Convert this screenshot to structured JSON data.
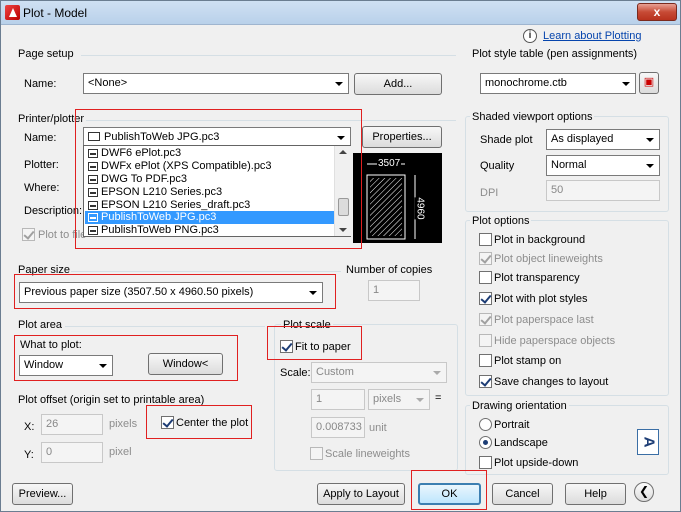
{
  "window": {
    "title": "Plot - Model",
    "close_label": "x",
    "info_link": "Learn about Plotting"
  },
  "page_setup": {
    "heading": "Page setup",
    "name_label": "Name:",
    "name_value": "<None>",
    "add_button": "Add..."
  },
  "printer": {
    "heading": "Printer/plotter",
    "name_label": "Name:",
    "name_value": "PublishToWeb JPG.pc3",
    "properties_button": "Properties...",
    "plotter_label": "Plotter:",
    "where_label": "Where:",
    "description_label": "Description:",
    "plot_to_file_label": "Plot to file",
    "dropdown_items": [
      "DWF6 ePlot.pc3",
      "DWFx ePlot (XPS Compatible).pc3",
      "DWG To PDF.pc3",
      "EPSON L210 Series.pc3",
      "EPSON L210 Series_draft.pc3",
      "PublishToWeb JPG.pc3",
      "PublishToWeb PNG.pc3"
    ],
    "selected_index": 5,
    "preview_width": "3507",
    "preview_height": "4960"
  },
  "paper_size": {
    "heading": "Paper size",
    "value": "Previous paper size  (3507.50 x 4960.50 pixels)"
  },
  "copies": {
    "heading": "Number of copies",
    "value": "1"
  },
  "plot_area": {
    "heading": "Plot area",
    "what_label": "What to plot:",
    "what_value": "Window",
    "window_button": "Window<"
  },
  "plot_scale": {
    "heading": "Plot scale",
    "fit_label": "Fit to paper",
    "scale_label": "Scale:",
    "scale_value": "Custom",
    "value1": "1",
    "unit1": "pixels",
    "equals": "=",
    "value2": "0.008733",
    "unit2": "unit",
    "lineweights_label": "Scale lineweights"
  },
  "plot_offset": {
    "heading": "Plot offset (origin set to printable area)",
    "x_label": "X:",
    "x_value": "26",
    "x_unit": "pixels",
    "y_label": "Y:",
    "y_value": "0",
    "y_unit": "pixel",
    "center_label": "Center the plot"
  },
  "style_table": {
    "heading": "Plot style table (pen assignments)",
    "value": "monochrome.ctb"
  },
  "shaded": {
    "heading": "Shaded viewport options",
    "shade_label": "Shade plot",
    "shade_value": "As displayed",
    "quality_label": "Quality",
    "quality_value": "Normal",
    "dpi_label": "DPI",
    "dpi_value": "50"
  },
  "plot_options": {
    "heading": "Plot options",
    "items": [
      "Plot in background",
      "Plot object lineweights",
      "Plot transparency",
      "Plot with plot styles",
      "Plot paperspace last",
      "Hide paperspace objects",
      "Plot stamp on",
      "Save changes to layout"
    ]
  },
  "orientation": {
    "heading": "Drawing orientation",
    "portrait": "Portrait",
    "landscape": "Landscape",
    "upside_down": "Plot upside-down",
    "orientation_glyph": "A"
  },
  "footer": {
    "preview": "Preview...",
    "apply": "Apply to Layout",
    "ok": "OK",
    "cancel": "Cancel",
    "help": "Help"
  }
}
